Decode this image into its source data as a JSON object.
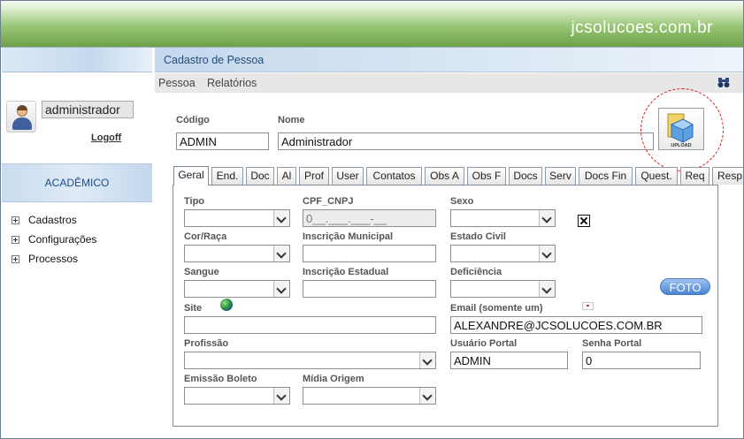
{
  "app": {
    "brand": "jcsolucoes.com.br"
  },
  "sidebar": {
    "username": "administrador",
    "logoff": "Logoff",
    "section": "ACADÊMICO",
    "items": [
      {
        "label": "Cadastros"
      },
      {
        "label": "Configurações"
      },
      {
        "label": "Processos"
      }
    ]
  },
  "page": {
    "title": "Cadastro de Pessoa",
    "menu": [
      {
        "label": "Pessoa"
      },
      {
        "label": "Relatórios"
      }
    ]
  },
  "form": {
    "codigo_label": "Código",
    "codigo_value": "ADMIN",
    "nome_label": "Nome",
    "nome_value": "Administrador",
    "upload_label": "UPLOAD",
    "tipo_label": "Tipo",
    "cpf_label": "CPF_CNPJ",
    "cpf_value": "0__.___.___-__",
    "sexo_label": "Sexo",
    "cor_label": "Cor/Raça",
    "inscr_mun_label": "Inscrição Municipal",
    "estado_civil_label": "Estado Civil",
    "sangue_label": "Sangue",
    "inscr_est_label": "Inscrição Estadual",
    "deficiencia_label": "Deficiência",
    "foto_label": "FOTO",
    "site_label": "Site",
    "email_label": "Email (somente um)",
    "email_value": "ALEXANDRE@JCSOLUCOES.COM.BR",
    "profissao_label": "Profissão",
    "usuario_portal_label": "Usuário Portal",
    "usuario_portal_value": "ADMIN",
    "senha_portal_label": "Senha Portal",
    "senha_portal_value": "0",
    "emissao_boleto_label": "Emissão Boleto",
    "midia_origem_label": "Mídia Origem"
  },
  "tabs": [
    {
      "label": "Geral"
    },
    {
      "label": "End."
    },
    {
      "label": "Doc"
    },
    {
      "label": "Al"
    },
    {
      "label": "Prof"
    },
    {
      "label": "User"
    },
    {
      "label": "Contatos"
    },
    {
      "label": "Obs A"
    },
    {
      "label": "Obs F"
    },
    {
      "label": "Docs"
    },
    {
      "label": "Serv"
    },
    {
      "label": "Docs Fin"
    },
    {
      "label": "Quest."
    },
    {
      "label": "Req"
    },
    {
      "label": "Resp"
    }
  ],
  "colors": {
    "header_green": "#6ea048",
    "title_blue": "#264c7a",
    "foto_blue": "#4a84d6",
    "highlight_red": "#d31f1f"
  }
}
